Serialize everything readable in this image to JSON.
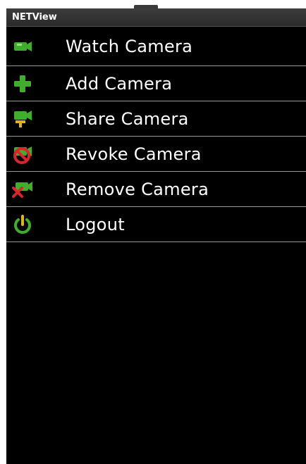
{
  "app": {
    "title": "NETView"
  },
  "menu": {
    "items": [
      {
        "label": "Watch Camera",
        "icon": "camera-icon"
      },
      {
        "label": "Add Camera",
        "icon": "plus-icon"
      },
      {
        "label": "Share Camera",
        "icon": "share-camera-icon"
      },
      {
        "label": "Revoke Camera",
        "icon": "revoke-camera-icon"
      },
      {
        "label": "Remove Camera",
        "icon": "remove-camera-icon"
      },
      {
        "label": "Logout",
        "icon": "power-icon"
      }
    ]
  },
  "colors": {
    "background": "#000000",
    "text": "#ffffff",
    "icon_green": "#3fae2a",
    "icon_red": "#d8262c",
    "icon_yellow": "#e0b21e",
    "divider": "#9a9a9a"
  }
}
